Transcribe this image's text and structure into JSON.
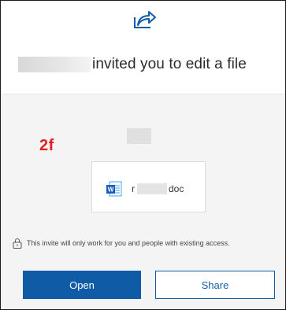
{
  "dialog": {
    "title_suffix": "invited you to edit a file"
  },
  "annotation": "2f",
  "file": {
    "name_prefix": "r",
    "name_suffix": "doc",
    "icon": "word-doc-icon"
  },
  "notice": {
    "text": "This invite will only work for you and people with existing access.",
    "icon": "lock-icon"
  },
  "buttons": {
    "open_label": "Open",
    "share_label": "Share"
  },
  "colors": {
    "accent": "#0f5ba6",
    "annotation": "#e02020",
    "background": "#f4f4f4"
  }
}
